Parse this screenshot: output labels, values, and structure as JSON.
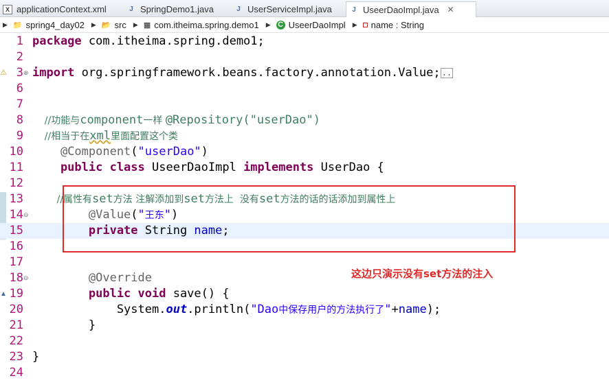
{
  "tabs": [
    {
      "label": "applicationContext.xml",
      "icon": "xml-file-icon"
    },
    {
      "label": "SpringDemo1.java",
      "icon": "java-file-icon"
    },
    {
      "label": "UserServiceImpl.java",
      "icon": "java-file-icon"
    },
    {
      "label": "UseerDaoImpl.java",
      "icon": "java-file-icon",
      "active": true,
      "close": "✕"
    }
  ],
  "breadcrumb": [
    "spring4_day02",
    "src",
    "com.itheima.spring.demo1",
    "UseerDaoImpl",
    "name : String"
  ],
  "line_numbers": [
    "1",
    "2",
    "3",
    "6",
    "7",
    "8",
    "9",
    "10",
    "11",
    "12",
    "13",
    "14",
    "15",
    "16",
    "17",
    "18",
    "19",
    "20",
    "21",
    "22",
    "23",
    "24"
  ],
  "code": {
    "l1_kw": "package",
    "l1_rest": " com.itheima.spring.demo1;",
    "l3_kw": "import",
    "l3_rest": " org.springframework.beans.factory.annotation.Value;",
    "l3_fold": "..",
    "l8_a": "    //功能与",
    "l8_b": "component",
    "l8_c": "一样 ",
    "l8_d": "@Repository(\"userDao\")",
    "l9_a": "    //相当于在",
    "l9_b": "xml",
    "l9_c": "里面配置这个类",
    "l10_an": "    @Component",
    "l10_p1": "(",
    "l10_st": "\"userDao\"",
    "l10_p2": ")",
    "l11_kw1": "    public class",
    "l11_mid": " UseerDaoImpl ",
    "l11_kw2": "implements",
    "l11_rest": " UserDao {",
    "l13_a": "        //属性有",
    "l13_b": "set",
    "l13_c": "方法 注解添加到",
    "l13_d": "set",
    "l13_e": "方法上  没有",
    "l13_f": "set",
    "l13_g": "方法的话的话添加到属性上",
    "l14_an": "        @Value",
    "l14_p1": "(",
    "l14_st1": "\"",
    "l14_cn": "王东",
    "l14_st2": "\"",
    "l14_p2": ")",
    "l15_kw": "        private",
    "l15_mid": " String ",
    "l15_fd": "name",
    "l15_end": ";",
    "l18_an": "        @Override",
    "l19_kw": "        public void",
    "l19_rest": " save() {",
    "l20_a": "            System.",
    "l20_sf": "out",
    "l20_b": ".println(",
    "l20_st1": "\"Dao",
    "l20_cn": "中保存用户的方法执行了",
    "l20_st2": "\"",
    "l20_c": "+",
    "l20_fd": "name",
    "l20_d": ");",
    "l21": "        }",
    "l23": "}"
  },
  "annotation_note": "这边只演示没有set方法的注入",
  "colors": {
    "keyword": "#7f0055",
    "comment": "#3f7f5f",
    "string": "#2a00ff",
    "field": "#0000c0",
    "line_number": "#b3147a",
    "highlight_box": "#e02a2a"
  }
}
